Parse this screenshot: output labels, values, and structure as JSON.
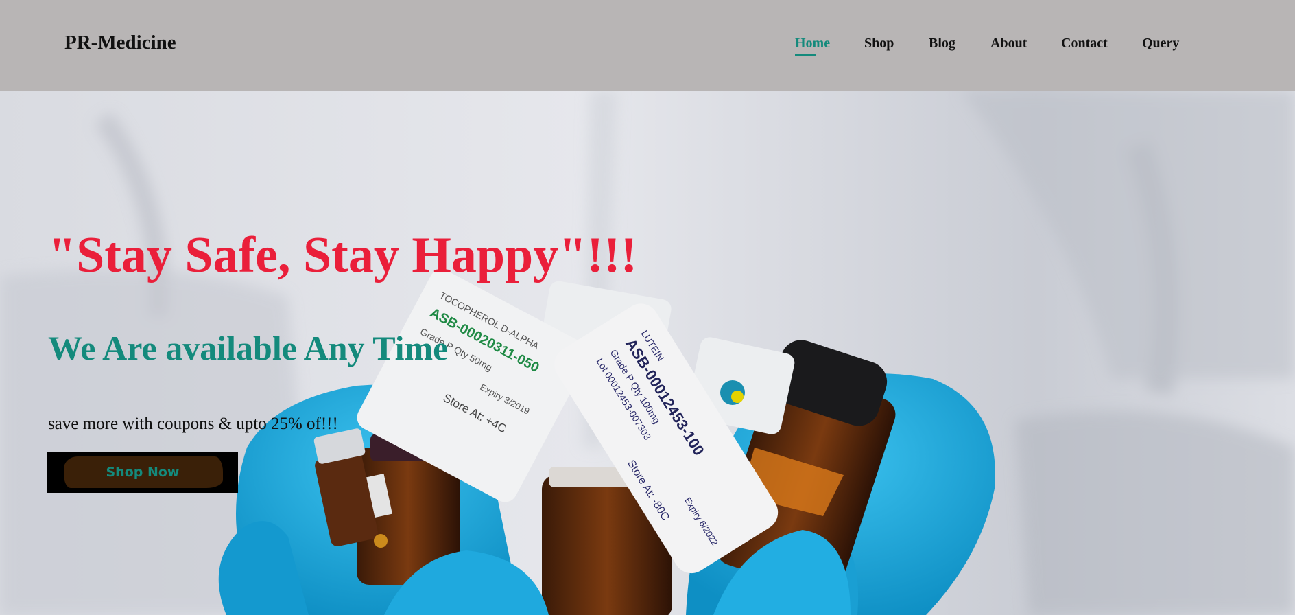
{
  "header": {
    "logo": "PR-Medicine",
    "nav": [
      {
        "label": "Home",
        "active": true
      },
      {
        "label": "Shop",
        "active": false
      },
      {
        "label": "Blog",
        "active": false
      },
      {
        "label": "About",
        "active": false
      },
      {
        "label": "Contact",
        "active": false
      },
      {
        "label": "Query",
        "active": false
      }
    ]
  },
  "hero": {
    "headline": "\"Stay Safe, Stay Happy\"!!!",
    "subheadline": "We Are available Any Time",
    "tagline": "save more with coupons & upto 25% of!!!",
    "cta_label": "Shop Now",
    "labels": {
      "left_label": {
        "line1": "TOCOPHEROL D-ALPHA",
        "line2": "ASB-00020311-050",
        "line3": "Grade P        Qty 50mg",
        "line4": "Store At: +4C",
        "line5": "Expiry 3/2019"
      },
      "right_label": {
        "line1": "LUTEIN",
        "line2": "ASB-00012453-100",
        "line3": "Grade P         Qty 100mg",
        "line4": "Lot 00012453-007303",
        "line5": "Store At: -80C",
        "line6": "Expiry 6/2022"
      }
    }
  },
  "colors": {
    "header_bg": "#b8b5b5",
    "accent_teal": "#148a7c",
    "headline_red": "#ea1f3a",
    "glove_blue": "#1aa6d8"
  }
}
